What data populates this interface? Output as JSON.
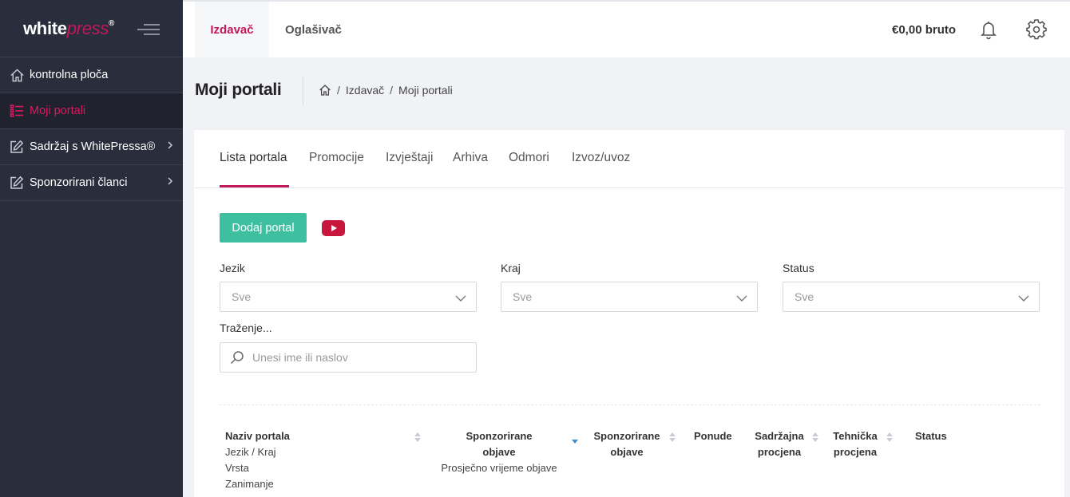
{
  "sidebar": {
    "logo_white": "white",
    "logo_press": "press",
    "logo_reg": "®",
    "items": [
      {
        "label": "kontrolna ploča",
        "icon": "home-icon"
      },
      {
        "label": "Moji portali",
        "icon": "list-icon",
        "active": true
      },
      {
        "label": "Sadržaj s WhitePressa®",
        "icon": "edit-icon",
        "has_children": true
      },
      {
        "label": "Sponzorirani članci",
        "icon": "edit-icon",
        "has_children": true
      }
    ]
  },
  "topbar": {
    "tabs": [
      {
        "label": "Izdavač",
        "active": true
      },
      {
        "label": "Oglašivač"
      }
    ],
    "balance": "€0,00 bruto",
    "icons": [
      "bell-icon",
      "gear-icon"
    ]
  },
  "page": {
    "title": "Moji portali",
    "breadcrumb": [
      "Izdavač",
      "Moji portali"
    ],
    "breadcrumb_sep": "/"
  },
  "tabs": [
    {
      "label": "Lista portala",
      "active": true
    },
    {
      "label": "Promocije"
    },
    {
      "label": "Izvještaji"
    },
    {
      "label": "Arhiva"
    },
    {
      "label": "Odmori"
    },
    {
      "label": "Izvoz/uvoz"
    }
  ],
  "actions": {
    "add_portal": "Dodaj portal"
  },
  "filters": {
    "language": {
      "label": "Jezik",
      "value": "Sve"
    },
    "region": {
      "label": "Kraj",
      "value": "Sve"
    },
    "status": {
      "label": "Status",
      "value": "Sve"
    },
    "search": {
      "label": "Traženje...",
      "placeholder": "Unesi ime ili naslov",
      "value": ""
    }
  },
  "table": {
    "columns": {
      "name": {
        "title": "Naziv portala",
        "subs": [
          "Jezik / Kraj",
          "Vrsta",
          "Zanimanje"
        ]
      },
      "sponsored_time": {
        "title": "Sponzorirane objave",
        "sub": "Prosječno vrijeme objave"
      },
      "sponsored": {
        "title": "Sponzorirane objave"
      },
      "offers": {
        "title": "Ponude"
      },
      "content_rating": {
        "title": "Sadržajna procjena"
      },
      "technical_rating": {
        "title": "Tehnička procjena"
      },
      "status": {
        "title": "Status"
      }
    }
  },
  "colors": {
    "accent": "#c2185b",
    "sidebar_bg": "#2a2d3b",
    "primary_button": "#3dbfa0",
    "youtube": "#c8173d"
  }
}
